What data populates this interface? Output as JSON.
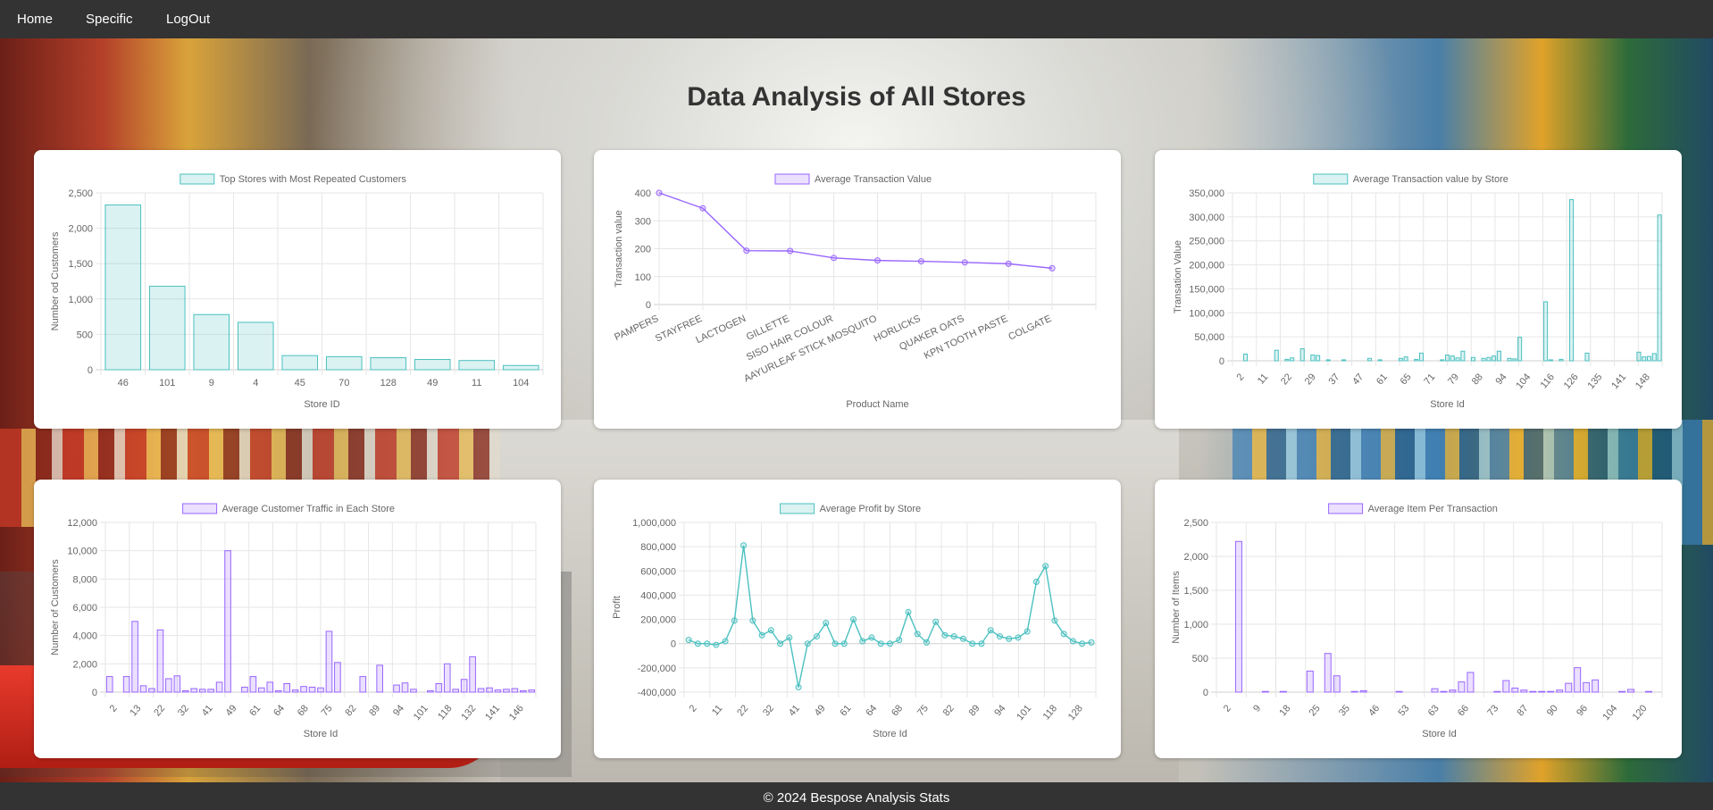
{
  "nav": {
    "home": "Home",
    "specific": "Specific",
    "logout": "LogOut"
  },
  "page": {
    "title": "Data Analysis of All Stores"
  },
  "footer": {
    "text": "© 2024 Bespose Analysis Stats"
  },
  "colors": {
    "teal": "#4bc0c0",
    "teal_fill": "rgba(75,192,192,0.2)",
    "purple": "#9966ff",
    "purple_fill": "rgba(153,102,255,0.2)"
  },
  "chart_data": [
    {
      "id": "c1",
      "type": "bar",
      "title": "Top Stores with Most Repeated Customers",
      "xlabel": "Store ID",
      "ylabel": "Number od Customers",
      "color": "teal",
      "ylim": [
        0,
        2500
      ],
      "yticks": [
        0,
        500,
        1000,
        1500,
        2000,
        2500
      ],
      "ytick_labels": [
        "0",
        "500",
        "1,000",
        "1,500",
        "2,000",
        "2,500"
      ],
      "categories": [
        "46",
        "101",
        "9",
        "4",
        "45",
        "70",
        "128",
        "49",
        "11",
        "104"
      ],
      "values": [
        2330,
        1180,
        780,
        670,
        200,
        185,
        170,
        145,
        130,
        60
      ]
    },
    {
      "id": "c2",
      "type": "line",
      "title": "Average Transaction Value",
      "xlabel": "Product Name",
      "ylabel": "Transaction value",
      "color": "purple",
      "ylim": [
        0,
        400
      ],
      "yticks": [
        0,
        100,
        200,
        300,
        400
      ],
      "ytick_labels": [
        "0",
        "100",
        "200",
        "300",
        "400"
      ],
      "categories": [
        "PAMPERS",
        "STAYFREE",
        "LACTOGEN",
        "GILLETTE",
        "SISO HAIR COLOUR",
        "AAYURLEAF STICK MOSQUITO",
        "HORLICKS",
        "QUAKER OATS",
        "KPN TOOTH PASTE",
        "COLGATE"
      ],
      "values": [
        400,
        345,
        193,
        192,
        167,
        158,
        155,
        151,
        146,
        130
      ]
    },
    {
      "id": "c3",
      "type": "bar",
      "title": "Average Transaction value by Store",
      "xlabel": "Store Id",
      "ylabel": "Transation Value",
      "color": "teal",
      "ylim": [
        0,
        350000
      ],
      "yticks": [
        0,
        50000,
        100000,
        150000,
        200000,
        250000,
        300000,
        350000
      ],
      "ytick_labels": [
        "0",
        "50,000",
        "100,000",
        "150,000",
        "200,000",
        "250,000",
        "300,000",
        "350,000"
      ],
      "tick_labels": [
        "2",
        "11",
        "22",
        "29",
        "37",
        "47",
        "61",
        "65",
        "71",
        "79",
        "88",
        "94",
        "104",
        "116",
        "126",
        "135",
        "141",
        "148"
      ],
      "values": [
        0,
        0,
        14000,
        0,
        0,
        0,
        0,
        0,
        22000,
        0,
        3000,
        6000,
        0,
        25000,
        0,
        12000,
        11000,
        0,
        2000,
        0,
        0,
        2000,
        0,
        0,
        0,
        0,
        5000,
        0,
        2000,
        0,
        0,
        0,
        5000,
        8000,
        0,
        3000,
        16000,
        0,
        0,
        0,
        2000,
        12000,
        10000,
        6000,
        20000,
        0,
        7000,
        0,
        5000,
        7000,
        10000,
        20000,
        0,
        5000,
        4000,
        49000,
        0,
        0,
        0,
        0,
        123000,
        2000,
        0,
        3000,
        0,
        336000,
        0,
        0,
        16000,
        0,
        0,
        0,
        0,
        0,
        0,
        0,
        0,
        0,
        18000,
        8000,
        9000,
        15000,
        304000
      ]
    },
    {
      "id": "c4",
      "type": "bar",
      "title": "Average Customer Traffic in Each Store",
      "xlabel": "Store Id",
      "ylabel": "Number of Customers",
      "color": "purple",
      "ylim": [
        0,
        12000
      ],
      "yticks": [
        0,
        2000,
        4000,
        6000,
        8000,
        10000,
        12000
      ],
      "ytick_labels": [
        "0",
        "2,000",
        "4,000",
        "6,000",
        "8,000",
        "10,000",
        "12,000"
      ],
      "tick_labels": [
        "2",
        "13",
        "22",
        "32",
        "41",
        "49",
        "61",
        "64",
        "68",
        "75",
        "82",
        "89",
        "94",
        "101",
        "118",
        "132",
        "141",
        "146"
      ],
      "values": [
        1100,
        0,
        1100,
        5000,
        450,
        250,
        4400,
        950,
        1150,
        100,
        250,
        200,
        200,
        700,
        10000,
        0,
        350,
        1100,
        300,
        700,
        100,
        600,
        150,
        400,
        350,
        300,
        4300,
        2100,
        0,
        0,
        1100,
        0,
        1900,
        0,
        500,
        650,
        200,
        0,
        100,
        600,
        2000,
        200,
        900,
        2500,
        250,
        300,
        150,
        200,
        250,
        100,
        150
      ]
    },
    {
      "id": "c5",
      "type": "line",
      "title": "Average Profit by Store",
      "xlabel": "Store Id",
      "ylabel": "Profit",
      "color": "teal",
      "ylim": [
        -400000,
        1000000
      ],
      "yticks": [
        -400000,
        -200000,
        0,
        200000,
        400000,
        600000,
        800000,
        1000000
      ],
      "ytick_labels": [
        "-400,000",
        "-200,000",
        "0",
        "200,000",
        "400,000",
        "600,000",
        "800,000",
        "1,000,000"
      ],
      "tick_labels": [
        "2",
        "11",
        "22",
        "32",
        "41",
        "49",
        "61",
        "64",
        "68",
        "75",
        "82",
        "89",
        "94",
        "101",
        "118",
        "128"
      ],
      "values": [
        30000,
        0,
        0,
        -10000,
        20000,
        190000,
        810000,
        190000,
        70000,
        110000,
        0,
        50000,
        -360000,
        0,
        60000,
        170000,
        0,
        0,
        200000,
        20000,
        50000,
        0,
        0,
        30000,
        260000,
        80000,
        10000,
        180000,
        70000,
        60000,
        40000,
        0,
        0,
        110000,
        60000,
        40000,
        50000,
        100000,
        510000,
        640000,
        190000,
        80000,
        20000,
        0,
        10000
      ]
    },
    {
      "id": "c6",
      "type": "bar",
      "title": "Average Item Per Transaction",
      "xlabel": "Store Id",
      "ylabel": "Number of Items",
      "color": "purple",
      "ylim": [
        0,
        2500
      ],
      "yticks": [
        0,
        500,
        1000,
        1500,
        2000,
        2500
      ],
      "ytick_labels": [
        "0",
        "500",
        "1,000",
        "1,500",
        "2,000",
        "2,500"
      ],
      "tick_labels": [
        "2",
        "9",
        "18",
        "25",
        "35",
        "46",
        "53",
        "63",
        "66",
        "73",
        "87",
        "90",
        "96",
        "104",
        "120"
      ],
      "values": [
        0,
        0,
        2220,
        0,
        0,
        10,
        0,
        10,
        0,
        0,
        310,
        0,
        570,
        240,
        0,
        10,
        20,
        0,
        0,
        0,
        10,
        0,
        0,
        0,
        50,
        10,
        30,
        150,
        290,
        0,
        0,
        10,
        170,
        60,
        30,
        10,
        10,
        10,
        30,
        130,
        360,
        140,
        180,
        0,
        0,
        10,
        40,
        0,
        10,
        0
      ]
    }
  ]
}
